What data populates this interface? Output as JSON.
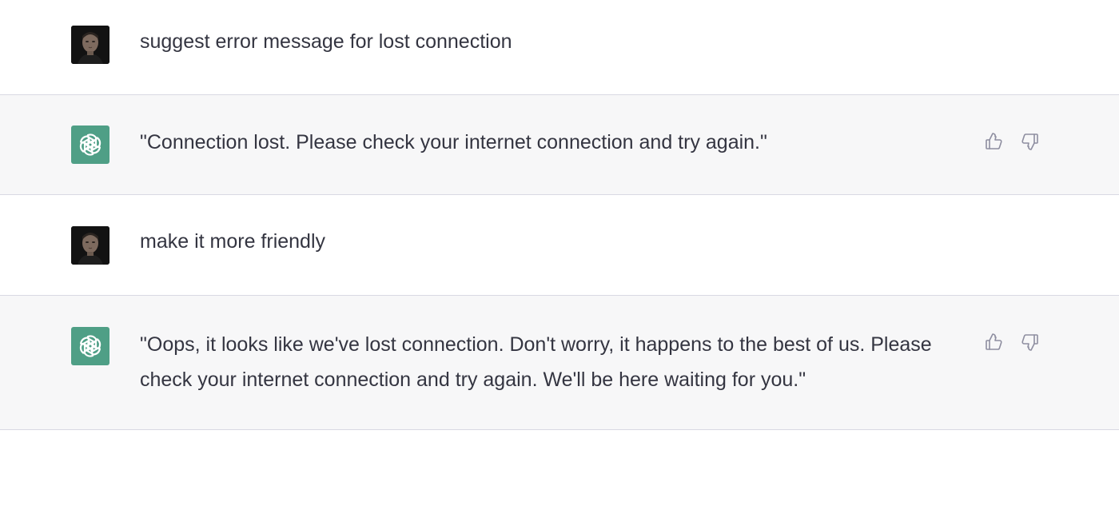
{
  "conversation": {
    "messages": [
      {
        "role": "user",
        "avatar": "user-photo",
        "text": "suggest error message for lost connection"
      },
      {
        "role": "assistant",
        "avatar": "openai-logo-icon",
        "text": "\"Connection lost. Please check your internet connection and try again.\"",
        "actions": [
          "thumbs-up-icon",
          "thumbs-down-icon"
        ]
      },
      {
        "role": "user",
        "avatar": "user-photo",
        "text": "make it more friendly"
      },
      {
        "role": "assistant",
        "avatar": "openai-logo-icon",
        "text": "\"Oops, it looks like we've lost connection. Don't worry, it happens to the best of us. Please check your internet connection and try again. We'll be here waiting for you.\"",
        "actions": [
          "thumbs-up-icon",
          "thumbs-down-icon"
        ]
      }
    ]
  },
  "colors": {
    "assistant_bg": "#f7f7f8",
    "user_bg": "#ffffff",
    "assistant_avatar": "#4f9f86",
    "text": "#343541",
    "icon": "#8e8ea0",
    "divider": "#d9d9e3"
  }
}
